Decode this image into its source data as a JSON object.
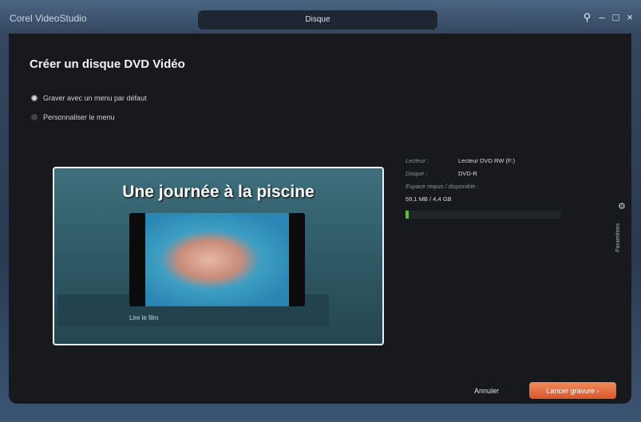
{
  "app": {
    "brand": "Corel VideoStudio",
    "window_title": "Disque"
  },
  "controls": {
    "pin": "⚲",
    "minimize": "–",
    "maximize": "□",
    "close": "×"
  },
  "main": {
    "title": "Créer un disque DVD Vidéo",
    "options": [
      {
        "label": "Graver avec un menu par défaut",
        "selected": true
      },
      {
        "label": "Personnaliser le menu",
        "selected": false
      }
    ],
    "preview": {
      "title": "Une journée à la piscine",
      "play_label": "Lire le film"
    },
    "info": {
      "drive_label": "Lecteur :",
      "drive_value": "Lecteur DVD RW (F:)",
      "disc_label": "Disque :",
      "disc_value": "DVD-R",
      "space_label": "Espace requis / disponible :",
      "space_value": "59,1 MB / 4,4 GB",
      "usage_percent": 2
    },
    "settings_label": "Paramètres",
    "cancel_label": "Annuler",
    "burn_label": "Lancer gravure ›"
  },
  "colors": {
    "accent": "#e8693c",
    "progress": "#56c23a"
  }
}
